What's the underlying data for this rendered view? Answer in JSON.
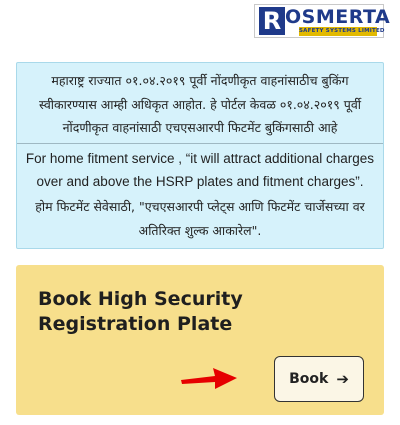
{
  "logo": {
    "letter": "R",
    "word": "OSMERTA",
    "tagline": "SAFETY SYSTEMS LIMITED"
  },
  "notice": {
    "marathi_lines": [
      "महाराष्ट्र राज्यात ०१.०४.२०१९ पूर्वी नोंदणीकृत वाहनांसाठीच बुकिंग",
      "स्वीकारण्यास आम्ही अधिकृत आहोत. हे पोर्टल केवळ ०१.०४.२०१९ पूर्वी",
      "नोंदणीकृत वाहनांसाठी एचएसआरपी फिटमेंट बुकिंगसाठी आहे"
    ],
    "english_lines": [
      "For home fitment service , “it will attract additional charges",
      "over and above the HSRP plates and fitment charges”."
    ],
    "marathi_charge_lines": [
      "होम फिटमेंट सेवेसाठी, \"एचएसआरपी प्लेट्स आणि फिटमेंट चार्जेसच्या वर",
      "अतिरिक्त शुल्क आकारेल\"."
    ]
  },
  "book_card": {
    "title_lines": [
      "Book High Security",
      "Registration Plate"
    ],
    "button_label": "Book",
    "button_arrow": "➔"
  },
  "colors": {
    "logo_blue": "#1f3a8a",
    "logo_yellow": "#e2b900",
    "notice_bg": "#d6f2fb",
    "card_bg": "#f7df8c",
    "pointer_arrow": "#e60000"
  }
}
